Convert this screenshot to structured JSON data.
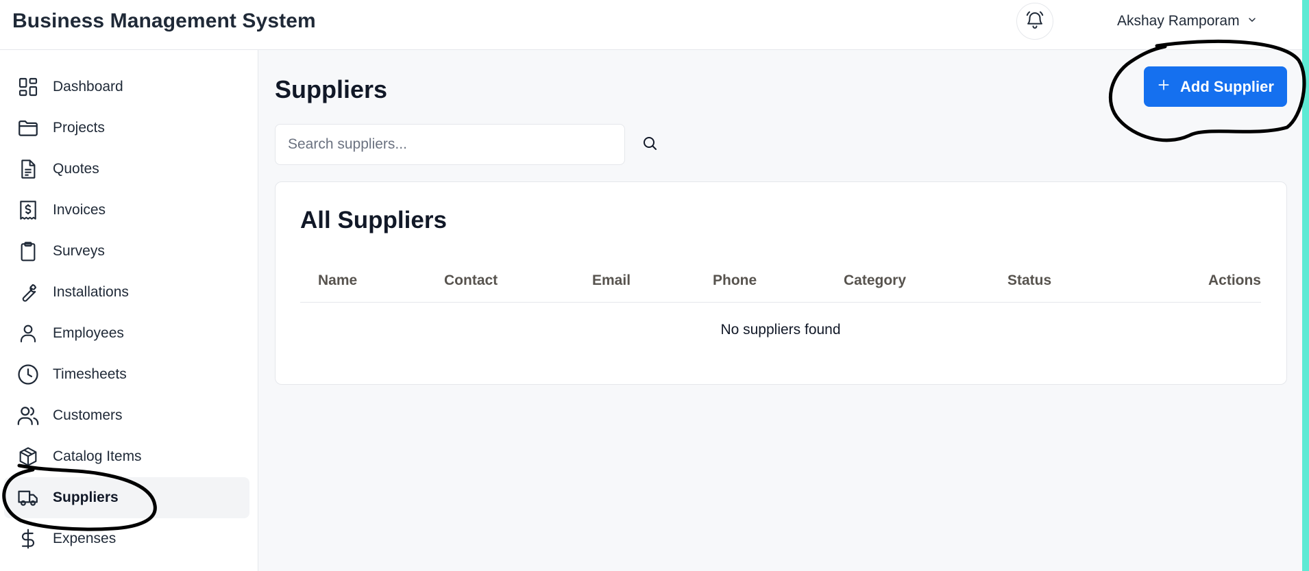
{
  "header": {
    "app_title": "Business Management System",
    "user_name": "Akshay Ramporam"
  },
  "sidebar": {
    "items": [
      {
        "label": "Dashboard",
        "icon": "dashboard-icon"
      },
      {
        "label": "Projects",
        "icon": "folder-icon"
      },
      {
        "label": "Quotes",
        "icon": "document-icon"
      },
      {
        "label": "Invoices",
        "icon": "receipt-icon"
      },
      {
        "label": "Surveys",
        "icon": "clipboard-icon"
      },
      {
        "label": "Installations",
        "icon": "wrench-icon"
      },
      {
        "label": "Employees",
        "icon": "user-icon"
      },
      {
        "label": "Timesheets",
        "icon": "clock-icon"
      },
      {
        "label": "Customers",
        "icon": "users-icon"
      },
      {
        "label": "Catalog Items",
        "icon": "package-icon"
      },
      {
        "label": "Suppliers",
        "icon": "truck-icon",
        "active": true
      },
      {
        "label": "Expenses",
        "icon": "dollar-icon"
      }
    ]
  },
  "main": {
    "page_title": "Suppliers",
    "add_button_label": "Add Supplier",
    "search_placeholder": "Search suppliers...",
    "card_title": "All Suppliers",
    "columns": [
      "Name",
      "Contact",
      "Email",
      "Phone",
      "Category",
      "Status",
      "Actions"
    ],
    "empty_message": "No suppliers found"
  },
  "colors": {
    "primary": "#1570ef",
    "accent_edge": "#5eead4",
    "active_nav_bg": "#f3f4f6",
    "annotation_ink": "#000000"
  }
}
